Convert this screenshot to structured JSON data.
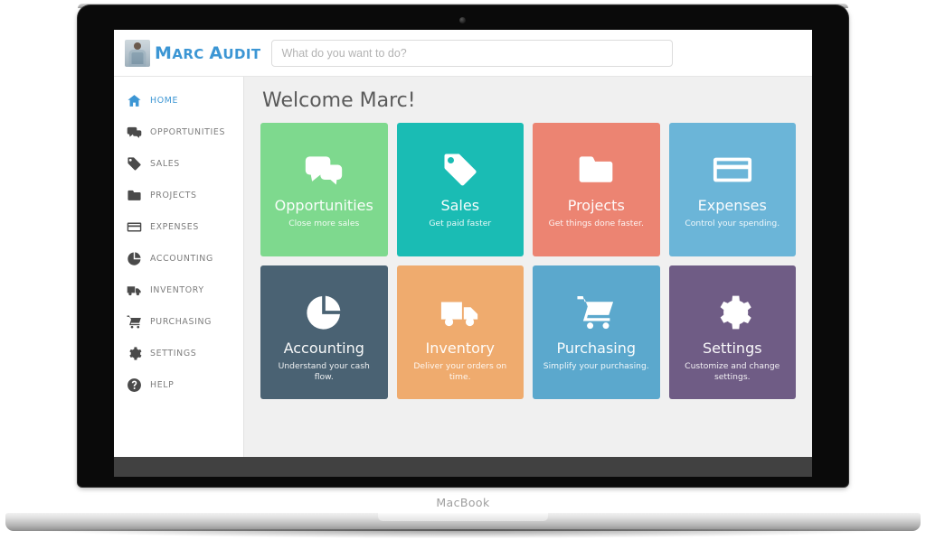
{
  "device": {
    "label": "MacBook",
    "camera_icon": "camera-dot"
  },
  "header": {
    "brand_name_first": "M",
    "brand_name": "ARC ",
    "brand_name_a": "A",
    "brand_name_rest": "UDIT",
    "brand_full": "Marc Audit",
    "avatar_icon": "user-photo-avatar",
    "search": {
      "placeholder": "What do you want to do?",
      "value": ""
    }
  },
  "sidebar": {
    "items": [
      {
        "label": "Home",
        "icon": "home-icon",
        "active": true
      },
      {
        "label": "Opportunities",
        "icon": "chat-icon",
        "active": false
      },
      {
        "label": "Sales",
        "icon": "tag-icon",
        "active": false
      },
      {
        "label": "Projects",
        "icon": "folder-icon",
        "active": false
      },
      {
        "label": "Expenses",
        "icon": "credit-card-icon",
        "active": false
      },
      {
        "label": "Accounting",
        "icon": "pie-chart-icon",
        "active": false
      },
      {
        "label": "Inventory",
        "icon": "truck-icon",
        "active": false
      },
      {
        "label": "Purchasing",
        "icon": "cart-icon",
        "active": false
      },
      {
        "label": "Settings",
        "icon": "gear-icon",
        "active": false
      },
      {
        "label": "Help",
        "icon": "question-icon",
        "active": false
      }
    ]
  },
  "main": {
    "page_title": "Welcome Marc!",
    "tiles": [
      {
        "title": "Opportunities",
        "subtitle": "Close more sales",
        "icon": "chat-icon",
        "color": "#7ed98e"
      },
      {
        "title": "Sales",
        "subtitle": "Get paid faster",
        "icon": "tag-icon",
        "color": "#1abcb4"
      },
      {
        "title": "Projects",
        "subtitle": "Get things done faster.",
        "icon": "folder-icon",
        "color": "#ec8472"
      },
      {
        "title": "Expenses",
        "subtitle": "Control your spending.",
        "icon": "credit-card-icon",
        "color": "#6bb5d8"
      },
      {
        "title": "Accounting",
        "subtitle": "Understand your cash flow.",
        "icon": "pie-chart-icon",
        "color": "#4a6273"
      },
      {
        "title": "Inventory",
        "subtitle": "Deliver your orders on time.",
        "icon": "truck-icon",
        "color": "#efab6e"
      },
      {
        "title": "Purchasing",
        "subtitle": "Simplify your purchasing.",
        "icon": "cart-icon",
        "color": "#5ba8cd"
      },
      {
        "title": "Settings",
        "subtitle": "Customize and change settings.",
        "icon": "gear-icon",
        "color": "#6f5c85"
      }
    ]
  },
  "colors": {
    "accent": "#3c96d4",
    "main_bg": "#f0f0f0",
    "sidebar_bg": "#ffffff"
  }
}
